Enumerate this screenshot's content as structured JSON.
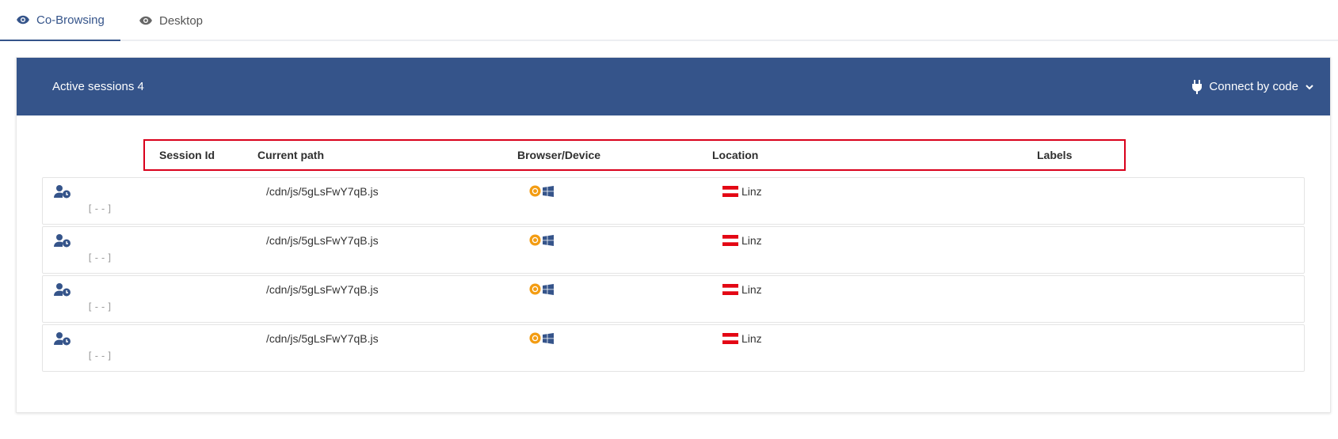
{
  "tabs": [
    {
      "label": "Co-Browsing",
      "icon": "eye-icon",
      "active": true
    },
    {
      "label": "Desktop",
      "icon": "eye-icon",
      "active": false
    }
  ],
  "header": {
    "title": "Active sessions 4",
    "connect_label": "Connect by code",
    "connect_icon": "plug-icon",
    "bg_color": "#35548a"
  },
  "table": {
    "columns": [
      "Session Id",
      "Current path",
      "Browser/Device",
      "Location",
      "Labels"
    ],
    "rows": [
      {
        "session_id": "[--]",
        "path": "/cdn/js/5gLsFwY7qB.js",
        "browser": "chrome-icon",
        "device": "windows-icon",
        "location": "Linz",
        "flag": "austria-flag"
      },
      {
        "session_id": "[--]",
        "path": "/cdn/js/5gLsFwY7qB.js",
        "browser": "chrome-icon",
        "device": "windows-icon",
        "location": "Linz",
        "flag": "austria-flag"
      },
      {
        "session_id": "[--]",
        "path": "/cdn/js/5gLsFwY7qB.js",
        "browser": "chrome-icon",
        "device": "windows-icon",
        "location": "Linz",
        "flag": "austria-flag"
      },
      {
        "session_id": "[--]",
        "path": "/cdn/js/5gLsFwY7qB.js",
        "browser": "chrome-icon",
        "device": "windows-icon",
        "location": "Linz",
        "flag": "austria-flag"
      }
    ]
  },
  "colors": {
    "accent": "#35548a",
    "highlight_border": "#d9001b",
    "chrome": "#f39c12"
  }
}
